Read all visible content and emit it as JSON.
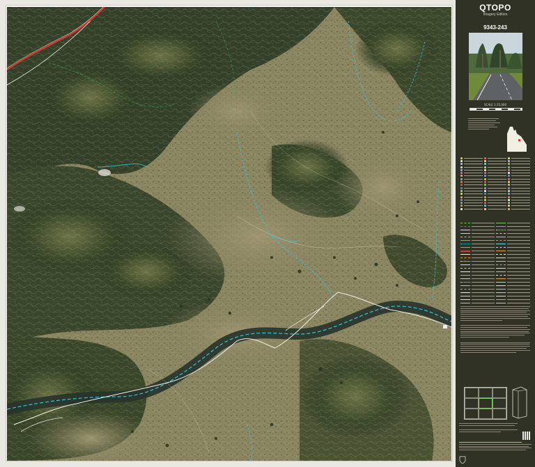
{
  "panel": {
    "brand": "QTOPO",
    "brand_sub": "Imagery Edition",
    "sheet_number": "9343-243",
    "scale_label": "SCALE 1:15,000"
  },
  "map_index": {
    "cells": [
      "",
      "",
      "",
      "",
      "",
      "",
      "",
      "",
      ""
    ]
  },
  "colors": {
    "panel_bg": "#303226",
    "terrain_dark": "#2f3b25",
    "terrain_mid": "#5c6440",
    "pasture": "#8d8a64",
    "river_veg": "#2b3a2d",
    "water": "#2ec4e0",
    "road": "#d43a2f",
    "fence": "#f2f0e6",
    "contour": "#b7ae80"
  },
  "icons": [
    "queensland-locator-icon",
    "qr-code-icon",
    "coat-of-arms-icon",
    "map-series-book-icon"
  ]
}
